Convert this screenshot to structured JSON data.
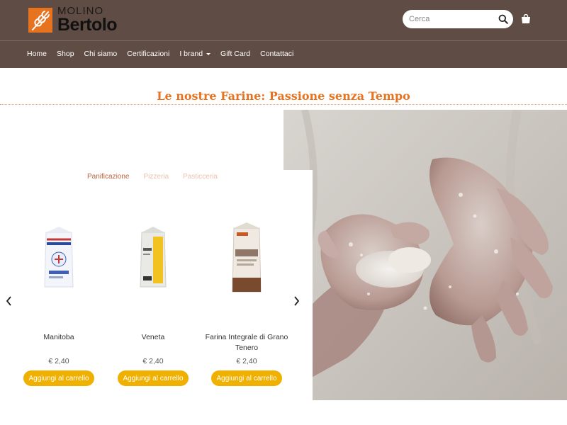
{
  "brand": {
    "small": "MOLINO",
    "big": "Bertolo",
    "color": "#e8731e"
  },
  "header": {
    "bg": "#5f4c44"
  },
  "search": {
    "placeholder": "Cerca"
  },
  "nav": [
    {
      "label": "Home"
    },
    {
      "label": "Shop"
    },
    {
      "label": "Chi siamo"
    },
    {
      "label": "Certificazioni"
    },
    {
      "label": "I brand",
      "dropdown": true
    },
    {
      "label": "Gift Card"
    },
    {
      "label": "Contattaci"
    }
  ],
  "section": {
    "title": "Le nostre Farine: Passione senza Tempo"
  },
  "tabs": [
    {
      "label": "Panificazione",
      "active": true
    },
    {
      "label": "Pizzeria",
      "active": false
    },
    {
      "label": "Pasticceria",
      "active": false
    }
  ],
  "products": [
    {
      "name": "Manitoba",
      "price": "€ 2,40",
      "button": "Aggiungi al carrello"
    },
    {
      "name": "Veneta",
      "price": "€ 2,40",
      "button": "Aggiungi al carrello"
    },
    {
      "name": "Farina Integrale di Grano Tenero",
      "price": "€ 2,40",
      "button": "Aggiungi al carrello"
    }
  ],
  "colors": {
    "accent_button": "#f0b000",
    "title": "#e8731e"
  }
}
